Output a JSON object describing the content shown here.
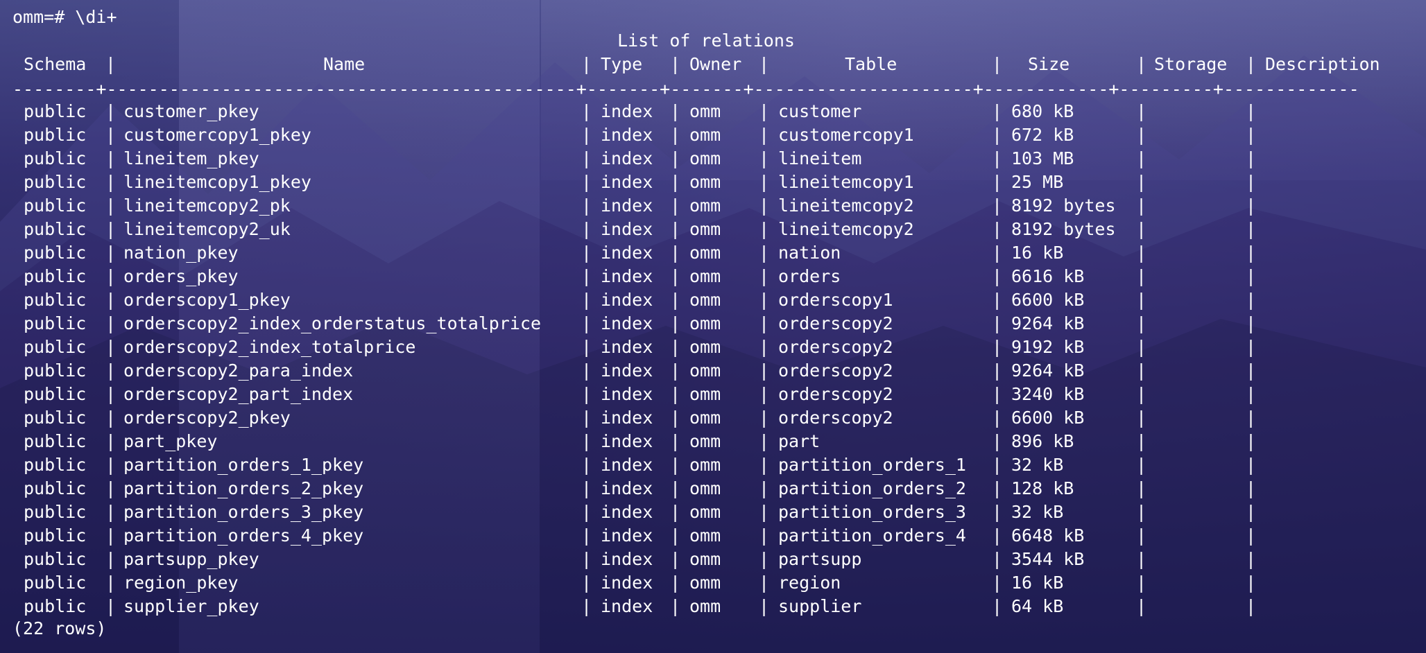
{
  "terminal": {
    "prompt": "omm=# \\di+",
    "table_title": "List of relations",
    "separator": "--------+---------------------------------------------+-------+-------+---------------------+------------+---------+-------------",
    "headers": {
      "schema": "Schema",
      "name": "Name",
      "type": "Type",
      "owner": "Owner",
      "table": "Table",
      "size": "Size",
      "storage": "Storage",
      "description": "Description"
    },
    "rows": [
      {
        "schema": "public",
        "name": "customer_pkey",
        "type": "index",
        "owner": "omm",
        "table": "customer",
        "size": "680 kB",
        "storage": "",
        "description": ""
      },
      {
        "schema": "public",
        "name": "customercopy1_pkey",
        "type": "index",
        "owner": "omm",
        "table": "customercopy1",
        "size": "672 kB",
        "storage": "",
        "description": ""
      },
      {
        "schema": "public",
        "name": "lineitem_pkey",
        "type": "index",
        "owner": "omm",
        "table": "lineitem",
        "size": "103 MB",
        "storage": "",
        "description": ""
      },
      {
        "schema": "public",
        "name": "lineitemcopy1_pkey",
        "type": "index",
        "owner": "omm",
        "table": "lineitemcopy1",
        "size": "25 MB",
        "storage": "",
        "description": ""
      },
      {
        "schema": "public",
        "name": "lineitemcopy2_pk",
        "type": "index",
        "owner": "omm",
        "table": "lineitemcopy2",
        "size": "8192 bytes",
        "storage": "",
        "description": ""
      },
      {
        "schema": "public",
        "name": "lineitemcopy2_uk",
        "type": "index",
        "owner": "omm",
        "table": "lineitemcopy2",
        "size": "8192 bytes",
        "storage": "",
        "description": ""
      },
      {
        "schema": "public",
        "name": "nation_pkey",
        "type": "index",
        "owner": "omm",
        "table": "nation",
        "size": "16 kB",
        "storage": "",
        "description": ""
      },
      {
        "schema": "public",
        "name": "orders_pkey",
        "type": "index",
        "owner": "omm",
        "table": "orders",
        "size": "6616 kB",
        "storage": "",
        "description": ""
      },
      {
        "schema": "public",
        "name": "orderscopy1_pkey",
        "type": "index",
        "owner": "omm",
        "table": "orderscopy1",
        "size": "6600 kB",
        "storage": "",
        "description": ""
      },
      {
        "schema": "public",
        "name": "orderscopy2_index_orderstatus_totalprice",
        "type": "index",
        "owner": "omm",
        "table": "orderscopy2",
        "size": "9264 kB",
        "storage": "",
        "description": ""
      },
      {
        "schema": "public",
        "name": "orderscopy2_index_totalprice",
        "type": "index",
        "owner": "omm",
        "table": "orderscopy2",
        "size": "9192 kB",
        "storage": "",
        "description": ""
      },
      {
        "schema": "public",
        "name": "orderscopy2_para_index",
        "type": "index",
        "owner": "omm",
        "table": "orderscopy2",
        "size": "9264 kB",
        "storage": "",
        "description": ""
      },
      {
        "schema": "public",
        "name": "orderscopy2_part_index",
        "type": "index",
        "owner": "omm",
        "table": "orderscopy2",
        "size": "3240 kB",
        "storage": "",
        "description": ""
      },
      {
        "schema": "public",
        "name": "orderscopy2_pkey",
        "type": "index",
        "owner": "omm",
        "table": "orderscopy2",
        "size": "6600 kB",
        "storage": "",
        "description": ""
      },
      {
        "schema": "public",
        "name": "part_pkey",
        "type": "index",
        "owner": "omm",
        "table": "part",
        "size": "896 kB",
        "storage": "",
        "description": ""
      },
      {
        "schema": "public",
        "name": "partition_orders_1_pkey",
        "type": "index",
        "owner": "omm",
        "table": "partition_orders_1",
        "size": "32 kB",
        "storage": "",
        "description": ""
      },
      {
        "schema": "public",
        "name": "partition_orders_2_pkey",
        "type": "index",
        "owner": "omm",
        "table": "partition_orders_2",
        "size": "128 kB",
        "storage": "",
        "description": ""
      },
      {
        "schema": "public",
        "name": "partition_orders_3_pkey",
        "type": "index",
        "owner": "omm",
        "table": "partition_orders_3",
        "size": "32 kB",
        "storage": "",
        "description": ""
      },
      {
        "schema": "public",
        "name": "partition_orders_4_pkey",
        "type": "index",
        "owner": "omm",
        "table": "partition_orders_4",
        "size": "6648 kB",
        "storage": "",
        "description": ""
      },
      {
        "schema": "public",
        "name": "partsupp_pkey",
        "type": "index",
        "owner": "omm",
        "table": "partsupp",
        "size": "3544 kB",
        "storage": "",
        "description": ""
      },
      {
        "schema": "public",
        "name": "region_pkey",
        "type": "index",
        "owner": "omm",
        "table": "region",
        "size": "16 kB",
        "storage": "",
        "description": ""
      },
      {
        "schema": "public",
        "name": "supplier_pkey",
        "type": "index",
        "owner": "omm",
        "table": "supplier",
        "size": "64 kB",
        "storage": "",
        "description": ""
      }
    ],
    "row_count": "(22 rows)"
  },
  "colors": {
    "text": "#ffffff",
    "background": "#1d1c4a"
  }
}
